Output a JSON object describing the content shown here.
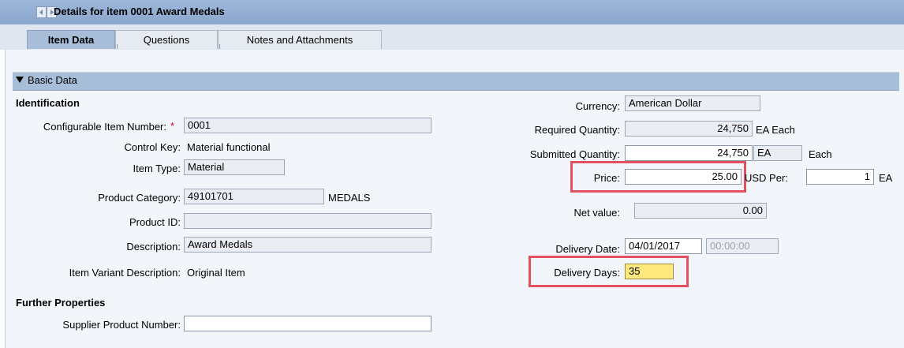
{
  "window": {
    "title": "Details for item 0001 Award Medals"
  },
  "tabs": [
    {
      "label": "Item Data",
      "active": true
    },
    {
      "label": "Questions",
      "active": false
    },
    {
      "label": "Notes and Attachments",
      "active": false
    }
  ],
  "section": {
    "label": "Basic Data"
  },
  "left": {
    "identification_heading": "Identification",
    "configurable_item_number": {
      "label": "Configurable Item Number:",
      "required_mark": "*",
      "value": "0001"
    },
    "control_key": {
      "label": "Control Key:",
      "value": "Material functional"
    },
    "item_type": {
      "label": "Item Type:",
      "value": "Material"
    },
    "product_category": {
      "label": "Product Category:",
      "value": "49101701",
      "description": "MEDALS"
    },
    "product_id": {
      "label": "Product ID:",
      "value": ""
    },
    "description": {
      "label": "Description:",
      "value": "Award Medals"
    },
    "item_variant_description": {
      "label": "Item Variant Description:",
      "value": "Original Item"
    },
    "further_properties_heading": "Further Properties",
    "supplier_product_number": {
      "label": "Supplier Product Number:",
      "value": ""
    }
  },
  "right": {
    "currency": {
      "label": "Currency:",
      "value": "American Dollar"
    },
    "required_quantity": {
      "label": "Required Quantity:",
      "value": "24,750",
      "unit": "EA Each"
    },
    "submitted_quantity": {
      "label": "Submitted Quantity:",
      "value": "24,750",
      "unit": "EA",
      "unit_text": "Each"
    },
    "price": {
      "label": "Price:",
      "value": "25.00",
      "currency_per": "USD Per:",
      "per_value": "1",
      "per_unit": "EA"
    },
    "net_value": {
      "label": "Net value:",
      "value": "0.00"
    },
    "delivery_date": {
      "label": "Delivery Date:",
      "date": "04/01/2017",
      "time": "00:00:00"
    },
    "delivery_days": {
      "label": "Delivery Days:",
      "value": "35"
    }
  },
  "colors": {
    "titlebar": "#9db8da",
    "section": "#a7bed9",
    "highlight": "#e4505f",
    "required": "#d0021b",
    "active_field": "#ffe97f"
  }
}
